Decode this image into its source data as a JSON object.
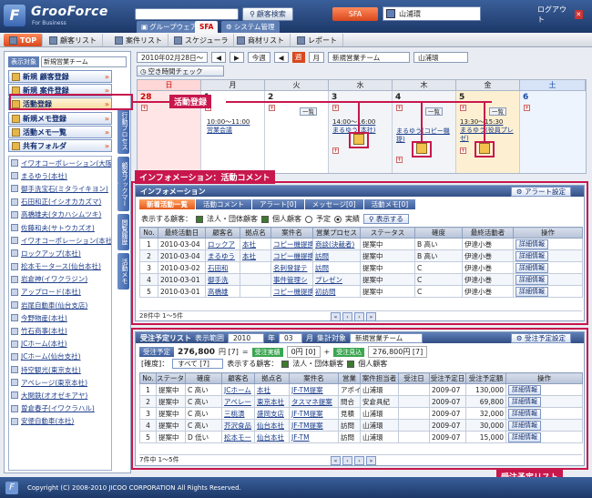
{
  "header": {
    "logo_name": "GrooForce",
    "logo_sub": "For Business",
    "search_button": "顧客検索",
    "tabs": [
      "グループウェア",
      "SFA",
      "システム管理"
    ],
    "sfa_tab": "SFA",
    "user": "山浦環",
    "logout": "ログアウト"
  },
  "menu": [
    "TOP",
    "顧客リスト",
    "案件リスト",
    "スケジューラ",
    "商材リスト",
    "レポート"
  ],
  "left": {
    "display_target_label": "表示対象",
    "display_target_value": "新規営業チーム",
    "buttons": [
      "新規 顧客登録",
      "新規 案件登録",
      "活動登録",
      "新規メモ登録",
      "活動メモ一覧",
      "共有フォルダ"
    ],
    "vertical_tabs": [
      "行動プロセス",
      "顧客ブックマーク",
      "閲覧履歴",
      "活動メモ"
    ],
    "customers": [
      "イワオコーポレーション(大阪支社)",
      "まるゆう(本社)",
      "御手洗宝石(ミタライキヨン)",
      "石田和正(イシオカカズマ)",
      "高橋雄夫(タカハシムツキ)",
      "佐藤和夫(サトウカズオ)",
      "イワオコーポレーション(本社)",
      "ロックアップ(本社)",
      "松本モータース(仙台本社)",
      "岩倉神(イワクラジン)",
      "アップロード(本社)",
      "岩尾自動車(仙台支店)",
      "今野物産(本社)",
      "竹石商事(本社)",
      "JCホーム(本社)",
      "JCホーム(仙台支社)",
      "持空観光(東京支社)",
      "アベレージ(東京本社)",
      "大関鉄(オオゼキアヤ)",
      "曽倉春子(イワクラハル)",
      "安徳自動車(本社)"
    ]
  },
  "calendar": {
    "date": "2010年02月28日～",
    "today": "今週",
    "week": "週",
    "month": "月",
    "team": "新規営業チーム",
    "person": "山浦環",
    "free_check": "空き時間チェック",
    "days": [
      "日",
      "月",
      "火",
      "水",
      "木",
      "金",
      "土"
    ],
    "dates": [
      "28",
      "1",
      "2",
      "3",
      "4",
      "5",
      "6"
    ],
    "list_label": "一覧",
    "events": {
      "mon": {
        "time": "10:00～11:00",
        "title": "営業会議"
      },
      "wed": {
        "time": "14:00～16:00",
        "title": "まるゆう(本社)"
      },
      "thu": {
        "time": "",
        "title": "まるゆう(コピー機提)"
      },
      "fri": {
        "time": "13:30～15:30",
        "title": "まるゆう(役員プレゼ)"
      }
    }
  },
  "annotations": {
    "activity": "活動登録",
    "info": "インフォメーション：活動コメント",
    "orders": "受注予定リスト"
  },
  "info": {
    "title": "インフォメーション",
    "alert_settings": "アラート設定",
    "tabs": [
      "新着活動一覧",
      "活動コメント",
      "アラート[0]",
      "メッセージ[0]",
      "活動メモ[0]"
    ],
    "filter_label": "表示する顧客：",
    "filter_corp": "法人・団体顧客",
    "filter_person": "個人顧客",
    "radio_plan": "予定",
    "radio_actual": "実績",
    "show_button": "表示する",
    "columns": [
      "No.",
      "最終活動日",
      "顧客名",
      "拠点名",
      "案件名",
      "営業プロセス",
      "ステータス",
      "確度",
      "最終活動者",
      "操作"
    ],
    "rows": [
      [
        "1",
        "2010-03-04",
        "ロックア",
        "本社",
        "コピー機提携",
        "商談(決裁者)",
        "提案中",
        "B 高い",
        "伊達小巻",
        "詳細情報"
      ],
      [
        "2",
        "2010-03-04",
        "まるゆう",
        "本社",
        "コピー機提携",
        "訪問",
        "提案中",
        "B 高い",
        "伊達小巻",
        "詳細情報"
      ],
      [
        "3",
        "2010-03-02",
        "石田和",
        "",
        "名刺登録テ",
        "訪問",
        "提案中",
        "C",
        "伊達小巻",
        "詳細情報"
      ],
      [
        "4",
        "2010-03-01",
        "御手洗",
        "",
        "事件管理シ",
        "プレゼン",
        "提案中",
        "C",
        "伊達小巻",
        "詳細情報"
      ],
      [
        "5",
        "2010-03-01",
        "高橋雄",
        "",
        "コピー機提携",
        "初訪問",
        "提案中",
        "C",
        "伊達小巻",
        "詳細情報"
      ]
    ],
    "count": "28件中 1～5件"
  },
  "orders": {
    "title": "受注予定リスト",
    "range_label": "表示範囲",
    "year": "2010",
    "year_unit": "年",
    "month": "03",
    "month_unit": "月",
    "target_label": "集計対象",
    "target": "新規営業チーム",
    "settings": "受注予定設定",
    "planned_label": "受注予定",
    "planned_amount": "276,800",
    "planned_unit": "円 [7]",
    "eq": "=",
    "actual_label": "受注実績",
    "actual_amount": "0円 [0]",
    "plus": "+",
    "prospect_label": "受注見込",
    "prospect_amount": "276,800円 [7]",
    "accuracy_label": "[確度]：",
    "accuracy": "すべて [7]",
    "filter_label": "表示する顧客：",
    "filter_corp": "法人・団体顧客",
    "filter_person": "個人顧客",
    "columns": [
      "No.",
      "ステータス",
      "確度",
      "顧客名",
      "拠点名",
      "案件名",
      "営業",
      "案件担当者",
      "受注日",
      "受注予定日",
      "受注予定額",
      "操作"
    ],
    "rows": [
      [
        "1",
        "提案中",
        "C 高い",
        "JCホーム",
        "本社",
        "JF-TM提案",
        "アポイ",
        "山浦環",
        "",
        "2009-07",
        "130,000",
        "詳細情報"
      ],
      [
        "2",
        "提案中",
        "C 高い",
        "アベレー",
        "東京本社",
        "タスマネ提案",
        "問合",
        "安倉具紀",
        "",
        "2009-07",
        "69,800",
        "詳細情報"
      ],
      [
        "3",
        "提案中",
        "C 高い",
        "三桃漬",
        "盛岡支店",
        "JF-TM提案",
        "見積",
        "山浦環",
        "",
        "2009-07",
        "32,000",
        "詳細情報"
      ],
      [
        "4",
        "提案中",
        "C 高い",
        "芥沢食品",
        "仙台本社",
        "JF-TM提案",
        "訪問",
        "山浦環",
        "",
        "2009-07",
        "30,000",
        "詳細情報"
      ],
      [
        "5",
        "提案中",
        "D 低い",
        "松本モー",
        "仙台本社",
        "JF-TM",
        "訪問",
        "山浦環",
        "",
        "2009-07",
        "15,000",
        "詳細情報"
      ]
    ],
    "count": "7件中 1～5件"
  },
  "footer": "Copyright (C) 2008-2010 JICOO CORPORATION All Rights Reserved."
}
